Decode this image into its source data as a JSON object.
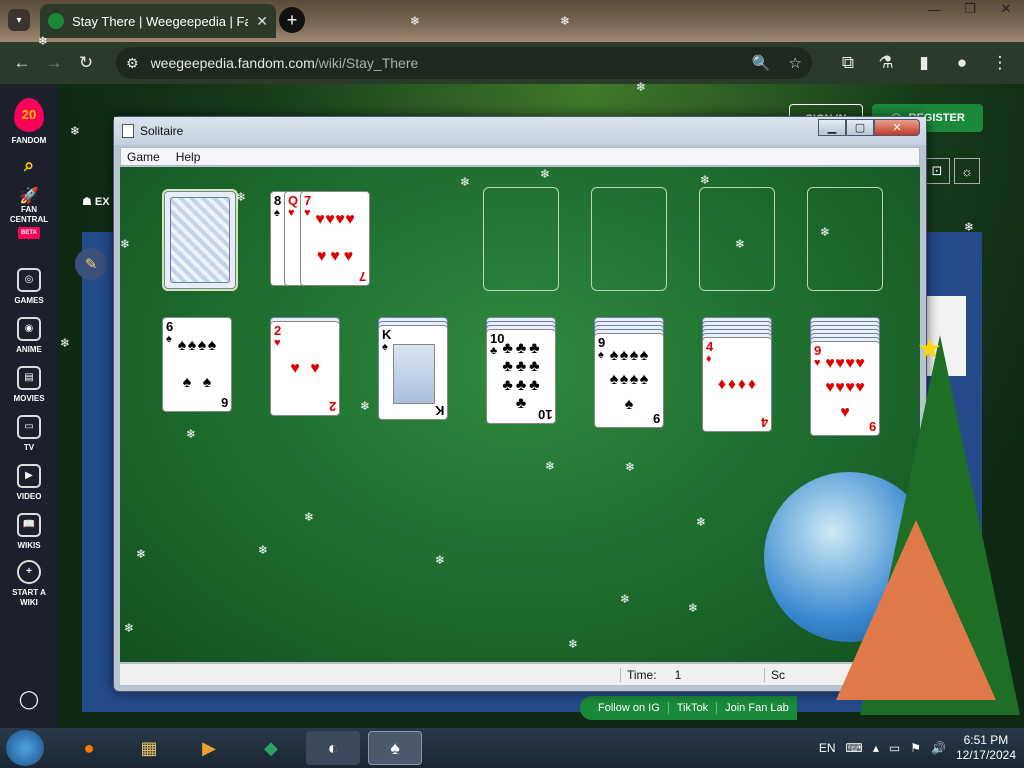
{
  "browser": {
    "tab_title": "Stay There | Weegeepedia | Fa",
    "url_host": "weegeepedia.fandom.com",
    "url_path": "/wiki/Stay_There"
  },
  "fandom_sidebar": {
    "logo_number": "20",
    "items": [
      {
        "label": "FANDOM"
      },
      {
        "label": "FAN CENTRAL",
        "badge": "BETA"
      },
      {
        "label": "GAMES"
      },
      {
        "label": "ANIME"
      },
      {
        "label": "MOVIES"
      },
      {
        "label": "TV"
      },
      {
        "label": "VIDEO"
      },
      {
        "label": "WIKIS"
      },
      {
        "label": "START A WIKI"
      }
    ]
  },
  "page": {
    "sign_in": "SIGN IN",
    "register": "REGISTER",
    "explore": "EX",
    "bottom_links": [
      "Follow on IG",
      "TikTok",
      "Join Fan Lab"
    ]
  },
  "solitaire": {
    "title": "Solitaire",
    "menu": [
      "Game",
      "Help"
    ],
    "status": {
      "time_label": "Time:",
      "time_value": "1",
      "score_label": "Sc"
    },
    "waste": [
      {
        "rank": "8",
        "suit": "♠",
        "color": "black"
      },
      {
        "rank": "Q",
        "suit": "♥",
        "color": "red"
      },
      {
        "rank": "7",
        "suit": "♥",
        "color": "red"
      }
    ],
    "tableau": [
      {
        "hidden": 0,
        "rank": "6",
        "suit": "♠",
        "color": "black",
        "pips": 6
      },
      {
        "hidden": 1,
        "rank": "2",
        "suit": "♥",
        "color": "red",
        "pips": 2
      },
      {
        "hidden": 2,
        "rank": "K",
        "suit": "♠",
        "color": "black",
        "pips": 0
      },
      {
        "hidden": 3,
        "rank": "10",
        "suit": "♣",
        "color": "black",
        "pips": 10
      },
      {
        "hidden": 4,
        "rank": "9",
        "suit": "♠",
        "color": "black",
        "pips": 9
      },
      {
        "hidden": 5,
        "rank": "4",
        "suit": "♦",
        "color": "red",
        "pips": 4
      },
      {
        "hidden": 6,
        "rank": "9",
        "suit": "♥",
        "color": "red",
        "pips": 9
      }
    ]
  },
  "taskbar": {
    "lang": "EN",
    "time": "6:51 PM",
    "date": "12/17/2024"
  },
  "colors": {
    "felt": "#1d6b2e",
    "fandom_pink": "#fa005a",
    "register_green": "#1a8a3a"
  }
}
